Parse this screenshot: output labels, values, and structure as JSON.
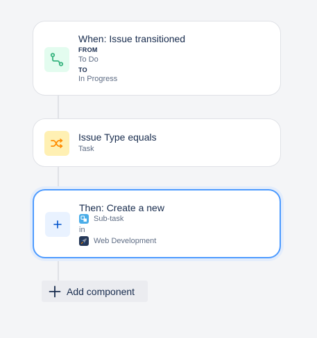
{
  "trigger": {
    "title": "When: Issue transitioned",
    "from_label": "FROM",
    "from_value": "To Do",
    "to_label": "TO",
    "to_value": "In Progress",
    "icon": "transition-icon",
    "icon_bg": "#e3fcef",
    "icon_color": "#36b37e"
  },
  "condition": {
    "title": "Issue Type equals",
    "value": "Task",
    "icon": "shuffle-icon",
    "icon_bg": "#fff0b3",
    "icon_color": "#ff8b00"
  },
  "action": {
    "title": "Then: Create a new",
    "issue_type": "Sub-task",
    "in_label": "in",
    "project": "Web Development",
    "icon": "plus-icon",
    "icon_bg": "#e9f2ff",
    "icon_color": "#0052cc"
  },
  "add_component": {
    "label": "Add component",
    "icon": "plus-icon"
  },
  "colors": {
    "background": "#f4f5f7",
    "selected_border": "#4c9aff",
    "connector": "#dfe1e6"
  }
}
